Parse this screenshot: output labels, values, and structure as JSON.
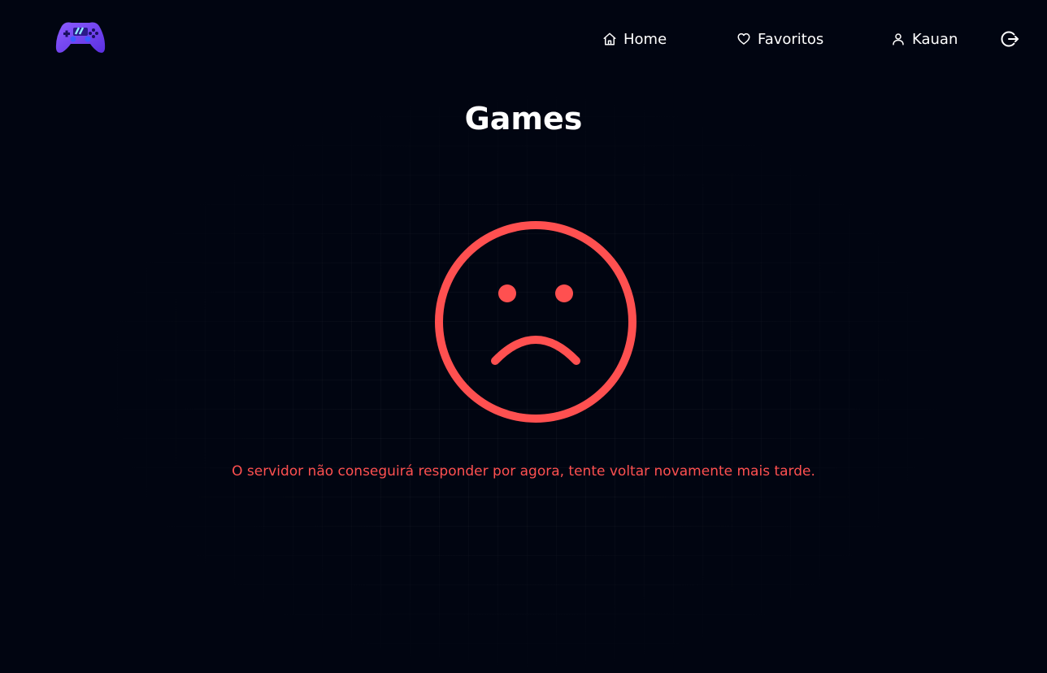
{
  "header": {
    "logo_icon": "gamepad-icon",
    "nav": [
      {
        "label": "Home",
        "icon": "home-icon"
      },
      {
        "label": "Favoritos",
        "icon": "heart-icon"
      },
      {
        "label": "Kauan",
        "icon": "user-icon"
      }
    ],
    "logout_icon": "logout-icon"
  },
  "main": {
    "title": "Games",
    "error_icon": "sad-face-icon",
    "error_message": "O servidor não conseguirá responder por agora, tente voltar novamente mais tarde."
  },
  "colors": {
    "background": "#010511",
    "error": "#ff5050",
    "logo_primary": "#7b4dff",
    "text": "#ffffff"
  }
}
